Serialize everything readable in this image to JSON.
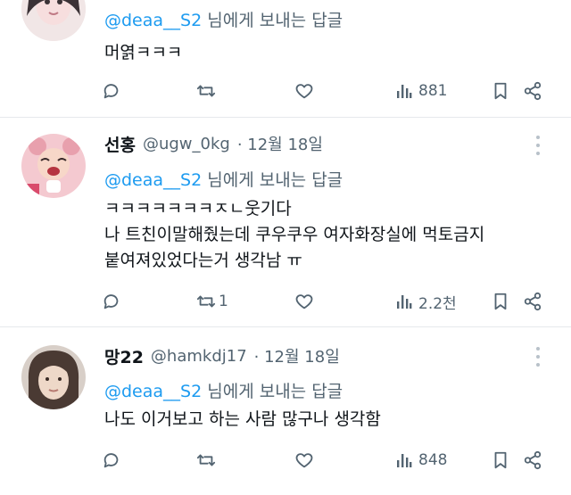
{
  "tweets": [
    {
      "name": "",
      "handle": "",
      "date": "",
      "reply_to": "@deaa__S2",
      "reply_suffix": "님에게 보내는 답글",
      "lines": [
        "머엵ㅋㅋㅋ"
      ],
      "retweets": "",
      "views": "881"
    },
    {
      "name": "선홍",
      "handle": "@ugw_0kg",
      "date": "· 12월 18일",
      "reply_to": "@deaa__S2",
      "reply_suffix": "님에게 보내는 답글",
      "lines": [
        "ㅋㅋㅋㅋㅋㅋㅋㅈㄴ웃기다",
        "나 트친이말해줬는데 쿠우쿠우 여자화장실에 먹토금지",
        "붙여져있었다는거 생각남 ㅠ"
      ],
      "retweets": "1",
      "views": "2.2천"
    },
    {
      "name": "망22",
      "handle": "@hamkdj17",
      "date": "· 12월 18일",
      "reply_to": "@deaa__S2",
      "reply_suffix": "님에게 보내는 답글",
      "lines": [
        "나도 이거보고 하는 사람 많구나 생각함"
      ],
      "retweets": "",
      "views": "848"
    }
  ],
  "colors": {
    "mention": "#1d9bf0",
    "secondary_text": "#536471",
    "icon": "#536471",
    "divider": "#e6e9ec"
  },
  "icons": [
    "reply-icon",
    "retweet-icon",
    "like-icon",
    "views-icon",
    "bookmark-icon",
    "share-icon",
    "more-icon"
  ]
}
